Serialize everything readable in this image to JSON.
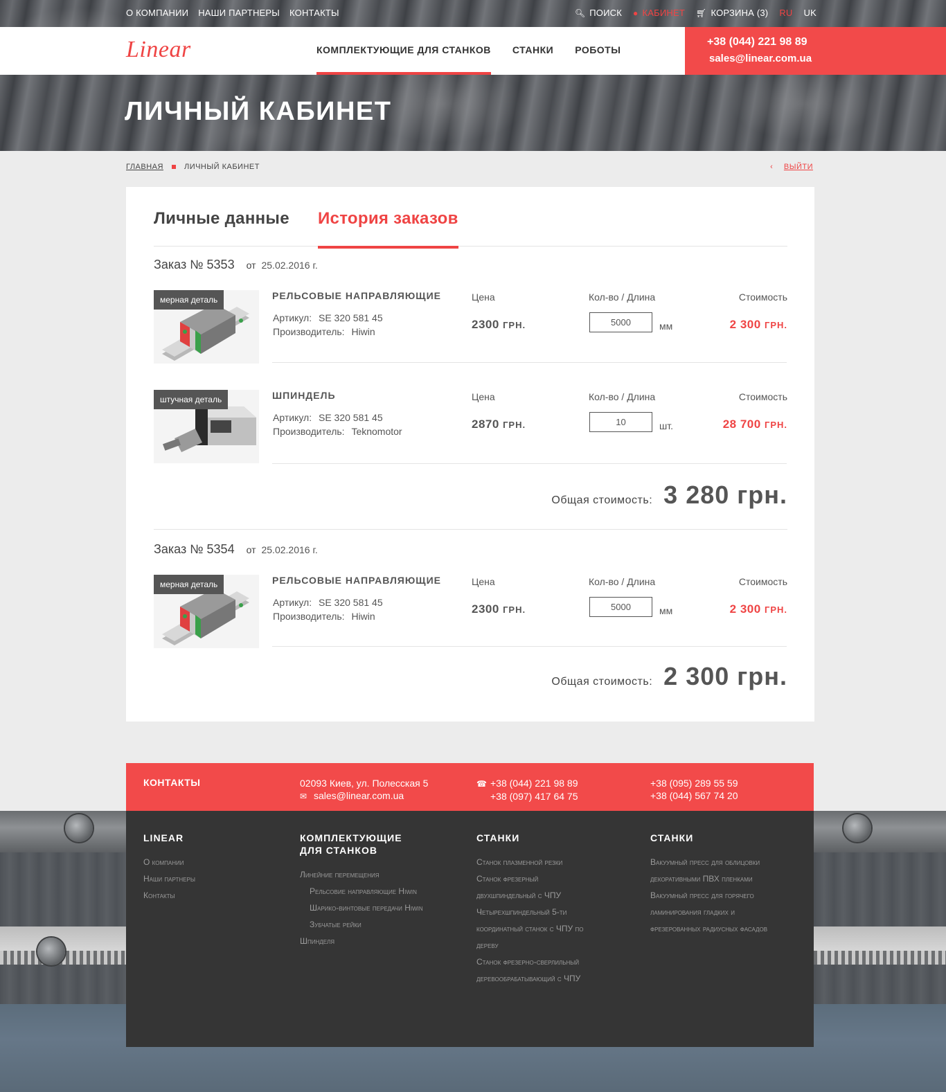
{
  "topbar": {
    "left_links": [
      "О компании",
      "Наши партнеры",
      "Контакты"
    ],
    "search_label": "Поиск",
    "cabinet_label": "Кабинет",
    "cart_label": "Корзина (3)",
    "lang_ru": "RU",
    "lang_uk": "UK"
  },
  "header": {
    "logo": "Linear",
    "nav": [
      "Комплектующие для станков",
      "Станки",
      "Роботы"
    ],
    "phone": "+38 (044) 221 98 89",
    "email": "sales@linear.com.ua"
  },
  "page": {
    "title": "Личный кабинет",
    "breadcrumb_home": "Главная",
    "breadcrumb_current": "Личный кабинет",
    "logout": "Выйти"
  },
  "tabs": {
    "personal": "Личные данные",
    "history": "История заказов"
  },
  "labels": {
    "order_prefix": "Заказ № ",
    "from": "от",
    "price": "Цена",
    "qty": "Кол-во / Длина",
    "cost": "Стоимость",
    "article": "Артикул:",
    "maker": "Производитель:",
    "total": "Общая стоимость:"
  },
  "orders": [
    {
      "number": "5353",
      "date": "25.02.2016 г.",
      "items": [
        {
          "badge": "мерная деталь",
          "name": "Рельсовые направляющие",
          "article": "SE 320 581 45",
          "maker": "Hiwin",
          "price": "2300",
          "price_unit": "грн.",
          "qty": "5000",
          "unit": "мм",
          "sum": "2 300",
          "sum_unit": "грн."
        },
        {
          "badge": "штучная деталь",
          "name": "Шпиндель",
          "article": "SE 320 581 45",
          "maker": "Teknomotor",
          "price": "2870",
          "price_unit": "грн.",
          "qty": "10",
          "unit": "шт.",
          "sum": "28 700",
          "sum_unit": "грн."
        }
      ],
      "total": "3 280 грн."
    },
    {
      "number": "5354",
      "date": "25.02.2016 г.",
      "items": [
        {
          "badge": "мерная деталь",
          "name": "Рельсовые направляющие",
          "article": "SE 320 581 45",
          "maker": "Hiwin",
          "price": "2300",
          "price_unit": "грн.",
          "qty": "5000",
          "unit": "мм",
          "sum": "2 300",
          "sum_unit": "грн."
        }
      ],
      "total": "2 300 грн."
    }
  ],
  "footer": {
    "contacts_title": "Контакты",
    "address": "02093 Киев, ул. Полесская 5",
    "email": "sales@linear.com.ua",
    "phone1": "+38 (044) 221 98 89",
    "phone2": "+38 (097) 417 64 75",
    "phone3": "+38 (095) 289 55 59",
    "phone4": "+38 (044) 567 74 20",
    "col1": {
      "title": "Linear",
      "links": [
        "О компании",
        "Наши партнеры",
        "Контакты"
      ]
    },
    "col2": {
      "title_line1": "Комплектующие",
      "title_line2": "для станков",
      "links": [
        "Линейние перемещения",
        "Рельсовие направляющие Hiwin",
        "Шарико-винтовые передачи Hiwin",
        "Зубчатые рейки",
        "Шпинделя"
      ]
    },
    "col3": {
      "title": "Станки",
      "links": [
        "Станок плазменной резки",
        "Станок фрезерный",
        "двухшпиндельный с ЧПУ",
        "Четырехшпиндельный 5-ти",
        "координатный станок с ЧПУ по",
        "дереву",
        "Станок фрезерно-сверлильный",
        "деревообрабатывающий с ЧПУ"
      ]
    },
    "col4": {
      "title": "Станки",
      "links": [
        "Вакуумный пресс для облицовки",
        "декоративными ПВХ пленками",
        "Вакуумный пресс для горячего",
        "ламинирования гладких и",
        "фрезерованных радиусных фасадов"
      ]
    }
  },
  "colors": {
    "accent": "#f24a4a",
    "dark": "#353535"
  }
}
